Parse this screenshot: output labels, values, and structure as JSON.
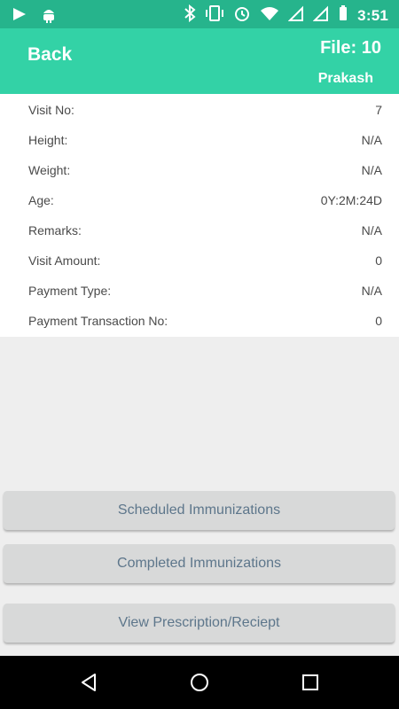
{
  "status_bar": {
    "time": "3:51"
  },
  "header": {
    "back_label": "Back",
    "file_label": "File: 10",
    "patient_name": "Prakash"
  },
  "details": [
    {
      "label": "Visit No:",
      "value": "7"
    },
    {
      "label": "Height:",
      "value": "N/A"
    },
    {
      "label": "Weight:",
      "value": "N/A"
    },
    {
      "label": "Age:",
      "value": "0Y:2M:24D"
    },
    {
      "label": "Remarks:",
      "value": "N/A"
    },
    {
      "label": "Visit Amount:",
      "value": "0"
    },
    {
      "label": "Payment Type:",
      "value": "N/A"
    },
    {
      "label": "Payment Transaction No:",
      "value": "0"
    }
  ],
  "buttons": {
    "scheduled": "Scheduled Immunizations",
    "completed": "Completed Immunizations",
    "prescription": "View Prescription/Reciept"
  },
  "nav_icons": [
    "back-triangle-icon",
    "home-circle-icon",
    "overview-square-icon"
  ]
}
